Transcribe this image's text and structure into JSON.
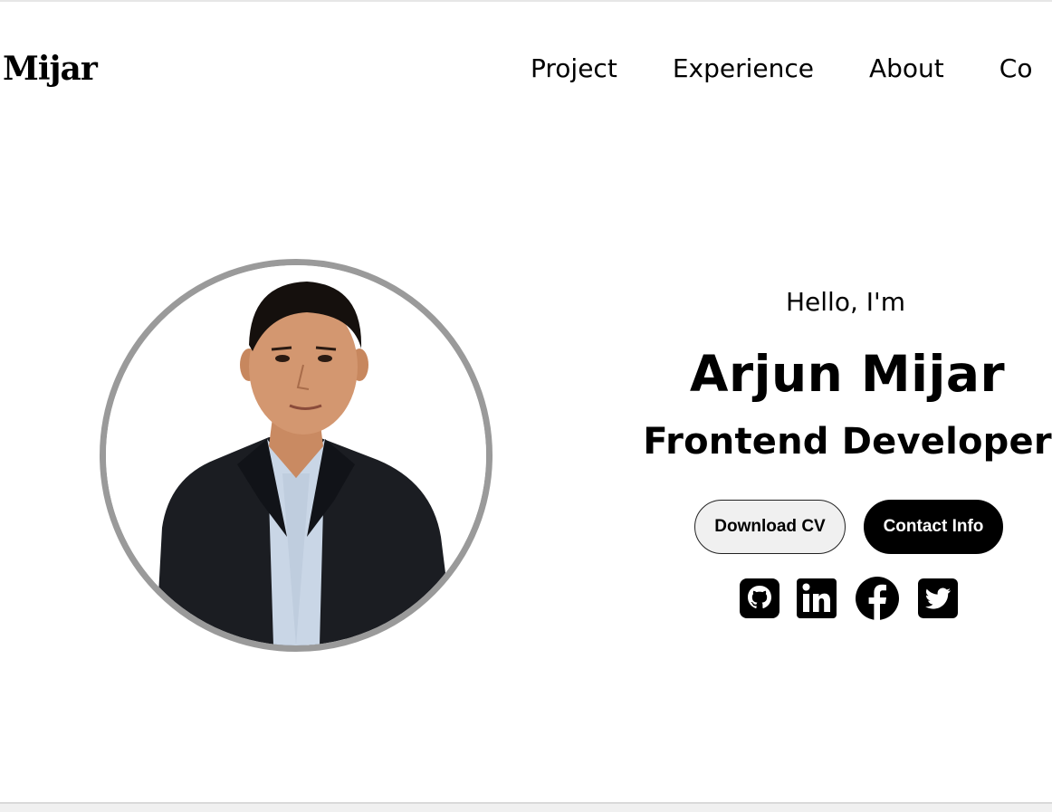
{
  "header": {
    "logo": "Mijar",
    "nav": [
      "Project",
      "Experience",
      "About",
      "Co"
    ]
  },
  "hero": {
    "greeting": "Hello, I'm",
    "name": "Arjun Mijar",
    "role": "Frontend Developer",
    "buttons": {
      "download": "Download CV",
      "contact": "Contact Info"
    },
    "social_icons": [
      "github-icon",
      "linkedin-icon",
      "facebook-icon",
      "twitter-icon"
    ]
  },
  "colors": {
    "text": "#000000",
    "ring": "#9a9a9a",
    "button_outline_bg": "#f0f0f0",
    "button_solid_bg": "#000000"
  }
}
